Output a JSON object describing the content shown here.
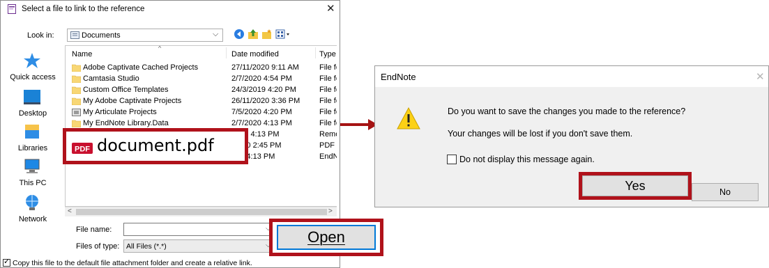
{
  "file_dialog": {
    "title": "Select a file to link to the reference",
    "close_glyph": "✕",
    "look_in_label": "Look in:",
    "look_in_value": "Documents",
    "places": [
      {
        "label": "Quick access",
        "icon": "star-icon"
      },
      {
        "label": "Desktop",
        "icon": "desktop-icon"
      },
      {
        "label": "Libraries",
        "icon": "libraries-icon"
      },
      {
        "label": "This PC",
        "icon": "computer-icon"
      },
      {
        "label": "Network",
        "icon": "network-icon"
      }
    ],
    "columns": {
      "name": "Name",
      "date": "Date modified",
      "type": "Type"
    },
    "rows": [
      {
        "name": "Adobe Captivate Cached Projects",
        "date": "27/11/2020 9:11 AM",
        "type": "File fo"
      },
      {
        "name": "Camtasia Studio",
        "date": "2/7/2020 4:54 PM",
        "type": "File fo"
      },
      {
        "name": "Custom Office Templates",
        "date": "24/3/2019 4:20 PM",
        "type": "File fo"
      },
      {
        "name": "My Adobe Captivate Projects",
        "date": "26/11/2020 3:36 PM",
        "type": "File fo"
      },
      {
        "name": "My Articulate Projects",
        "date": "7/5/2020 4:20 PM",
        "type": "File fo"
      },
      {
        "name": "My EndNote Library.Data",
        "date": "2/7/2020 4:13 PM",
        "type": "File fo"
      },
      {
        "name": "",
        "date": "2019 4:13 PM",
        "type": "Remo"
      },
      {
        "name": "",
        "date": "/2020 2:45 PM",
        "type": "PDF F"
      },
      {
        "name": "",
        "date": "020 4:13 PM",
        "type": "EndN"
      }
    ],
    "file_name_label": "File name:",
    "file_name_value": "",
    "files_of_type_label": "Files of type:",
    "files_of_type_value": "All Files (*.*)",
    "copy_label": "Copy this file to the default file attachment folder and create a relative link.",
    "copy_checked": true
  },
  "highlight_file": {
    "name": "document.pdf",
    "badge": "PDF"
  },
  "open_button": {
    "label": "Open"
  },
  "endnote_dialog": {
    "title": "EndNote",
    "close_glyph": "✕",
    "question": "Do you want to save the changes you made to the reference?",
    "subtext": "Your changes will be lost if you don't save them.",
    "checkbox_label": "Do not display this message again.",
    "yes_label": "Yes",
    "no_label": "No"
  },
  "colors": {
    "highlight": "#b0121b",
    "accent": "#0078d7",
    "folder": "#f8d775",
    "warning": "#fcd116"
  }
}
